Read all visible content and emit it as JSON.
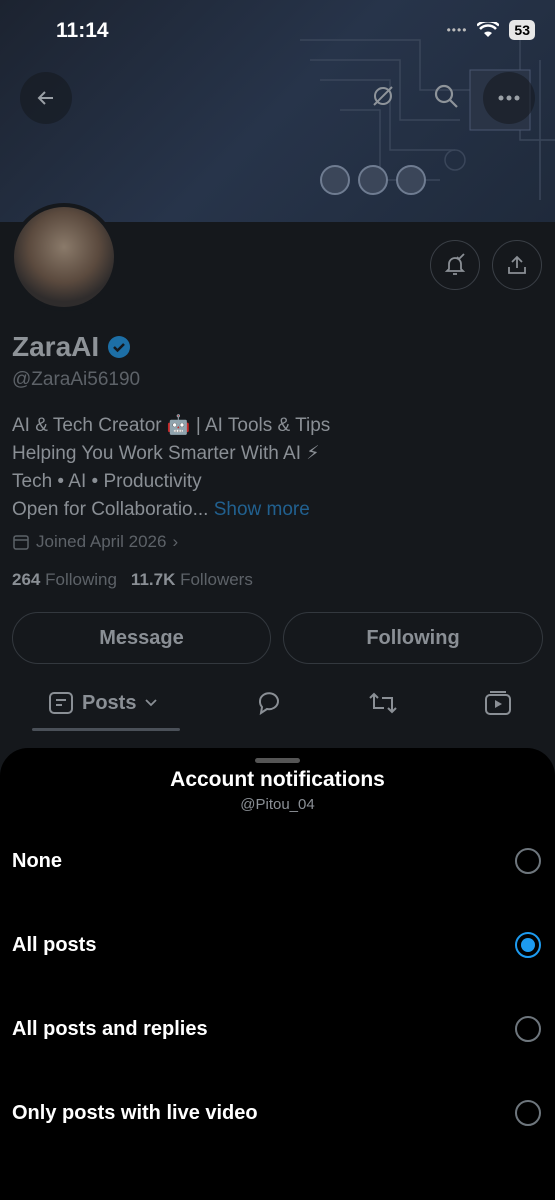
{
  "status_bar": {
    "time": "11:14",
    "battery": "53"
  },
  "profile": {
    "name": "ZaraAI",
    "handle": "@ZaraAi56190",
    "bio": [
      "AI & Tech Creator 🤖 | AI Tools & Tips",
      "Helping You Work Smarter With AI ⚡",
      "Tech • AI • Productivity",
      "Open for Collaboratio..."
    ],
    "show_more": "Show more",
    "joined": "Joined April 2026",
    "following_count": "264",
    "following_label": "Following",
    "followers_count": "11.7K",
    "followers_label": "Followers",
    "message_button": "Message",
    "following_button": "Following",
    "tabs": {
      "posts": "Posts"
    }
  },
  "sheet": {
    "title": "Account notifications",
    "subtitle": "@Pitou_04",
    "options": [
      {
        "label": "None",
        "selected": false
      },
      {
        "label": "All posts",
        "selected": true
      },
      {
        "label": "All posts and replies",
        "selected": false
      },
      {
        "label": "Only posts with live video",
        "selected": false
      }
    ]
  },
  "colors": {
    "accent": "#1d9bf0",
    "sheet_bg": "#000000"
  }
}
